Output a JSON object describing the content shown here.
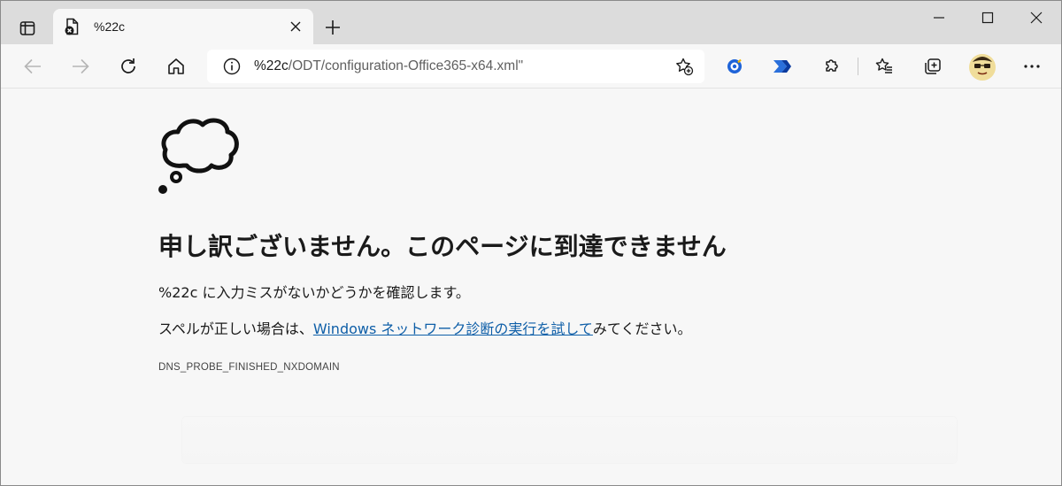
{
  "tab": {
    "title": "%22c",
    "new_tab_glyph": "+",
    "close_glyph": "×"
  },
  "window_controls": {
    "minimize": "—",
    "maximize": "☐",
    "close": "✕"
  },
  "address": {
    "host": "%22c",
    "path": "/ODT/configuration-Office365-x64.xml\""
  },
  "error": {
    "title": "申し訳ございません。このページに到達できません",
    "line1": "%22c に入力ミスがないかどうかを確認します。",
    "line2_prefix": "スペルが正しい場合は、",
    "line2_link": "Windows ネットワーク診断の実行を試して",
    "line2_suffix": "みてください。",
    "code": "DNS_PROBE_FINISHED_NXDOMAIN"
  },
  "colors": {
    "link": "#0f5fa8",
    "tabstrip": "#dcdcdc",
    "page_bg": "#f7f7f7"
  },
  "icons": {
    "tab_actions": "tab-actions-icon",
    "favicon": "error-file-icon",
    "back": "back-arrow-icon",
    "forward": "forward-arrow-icon",
    "refresh": "refresh-icon",
    "home": "home-icon",
    "info": "info-icon",
    "add_favorite": "add-favorite-icon",
    "extension1": "extension-blue-icon",
    "extension2": "power-automate-icon",
    "extensions": "puzzle-icon",
    "favorites": "favorites-icon",
    "collections": "collections-icon",
    "menu": "more-icon",
    "cloud": "thought-cloud-icon"
  }
}
